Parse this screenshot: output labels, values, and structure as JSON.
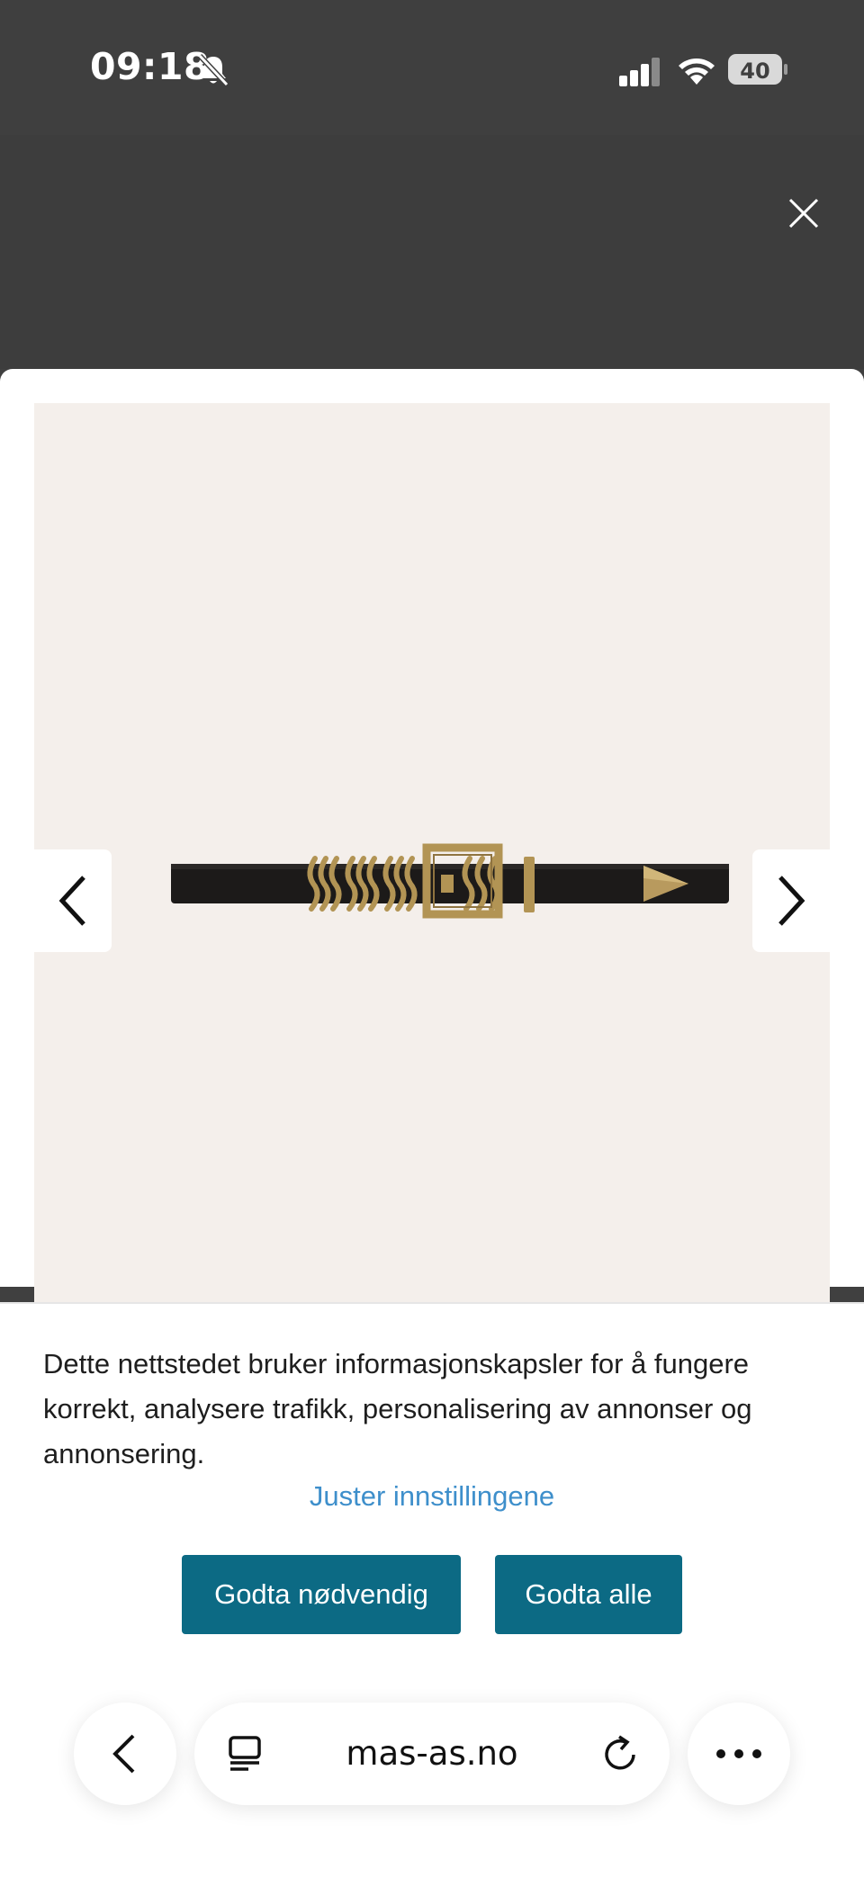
{
  "status_bar": {
    "time": "09:18",
    "battery_level": "40",
    "icons": [
      "bell-muted-icon",
      "cellular-signal-icon",
      "wifi-icon",
      "battery-icon"
    ]
  },
  "modal": {
    "close_icon": "close-icon",
    "product_image": "belt-photo",
    "prev_icon": "chevron-left-icon",
    "next_icon": "chevron-right-icon",
    "image_background": "#f4efeb"
  },
  "cookie_banner": {
    "message": "Dette nettstedet bruker informasjonskapsler for å fungere korrekt, analysere trafikk, personalisering av annonser og annonsering.",
    "adjust_link": "Juster innstillingene",
    "accept_necessary": "Godta nødvendig",
    "accept_all": "Godta alle",
    "button_color": "#0c6a84",
    "link_color": "#3e8fcb"
  },
  "browser_toolbar": {
    "url": "mas-as.no",
    "icons": [
      "back-icon",
      "tabs-icon",
      "reload-icon",
      "more-icon"
    ]
  }
}
